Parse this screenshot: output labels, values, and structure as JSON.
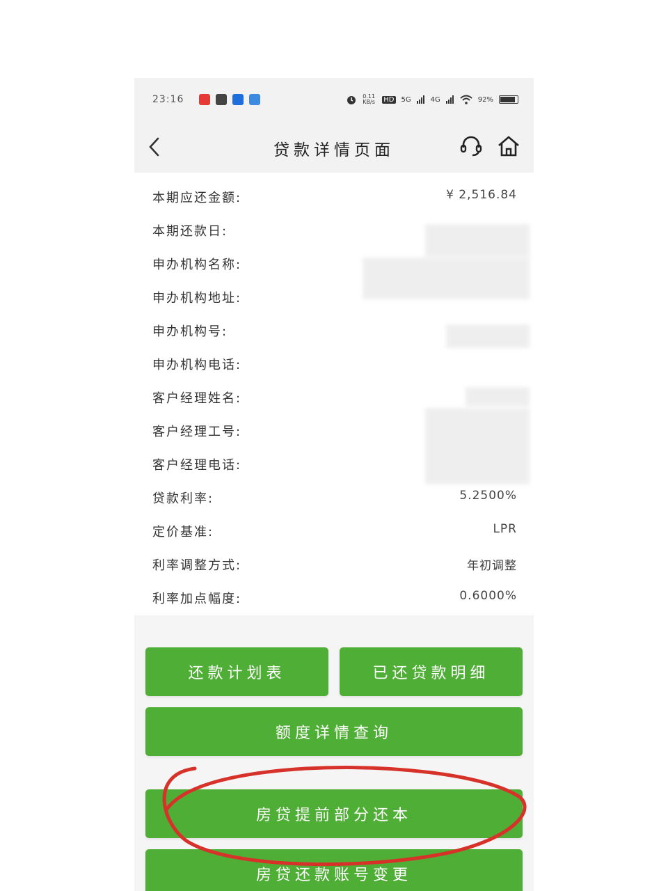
{
  "status_bar": {
    "time": "23:16",
    "net_speed": "0.11 KB/s",
    "hd": "HD",
    "sig1": "5G",
    "sig2": "4G",
    "battery": "92%",
    "battery_level": 0.92
  },
  "nav": {
    "title": "贷款详情页面"
  },
  "details": [
    {
      "label": "本期应还金额:",
      "value": "¥ 2,516.84"
    },
    {
      "label": "本期还款日:",
      "value": ""
    },
    {
      "label": "申办机构名称:",
      "value": ""
    },
    {
      "label": "申办机构地址:",
      "value": ""
    },
    {
      "label": "申办机构号:",
      "value": ""
    },
    {
      "label": "申办机构电话:",
      "value": ""
    },
    {
      "label": "客户经理姓名:",
      "value": ""
    },
    {
      "label": "客户经理工号:",
      "value": ""
    },
    {
      "label": "客户经理电话:",
      "value": ""
    },
    {
      "label": "贷款利率:",
      "value": "5.2500%"
    },
    {
      "label": "定价基准:",
      "value": "LPR"
    },
    {
      "label": "利率调整方式:",
      "value": "年初调整"
    },
    {
      "label": "利率加点幅度:",
      "value": "0.6000%"
    }
  ],
  "buttons": {
    "repayment_plan": "还款计划表",
    "repaid_details": "已还贷款明细",
    "limit_query": "额度详情查询",
    "early_partial": "房贷提前部分还本",
    "change_account": "房贷还款账号变更"
  },
  "colors": {
    "button_green": "#4fae35",
    "annotation_red": "#d7322a"
  }
}
